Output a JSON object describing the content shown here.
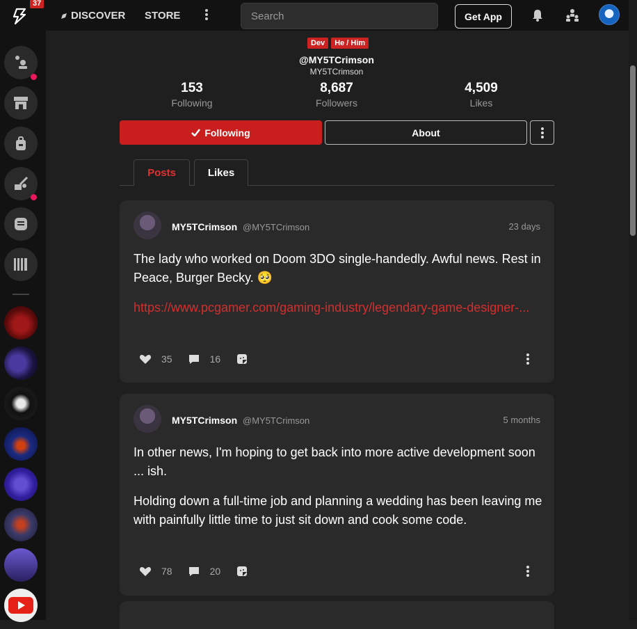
{
  "topbar": {
    "notification_count": "37",
    "discover_label": "DISCOVER",
    "store_label": "STORE",
    "search_placeholder": "Search",
    "get_app_label": "Get App"
  },
  "profile": {
    "badges": [
      "Dev",
      "He / Him"
    ],
    "handle": "@MY5TCrimson",
    "display_name": "MY5TCrimson",
    "stats": [
      {
        "value": "153",
        "label": "Following"
      },
      {
        "value": "8,687",
        "label": "Followers"
      },
      {
        "value": "4,509",
        "label": "Likes"
      }
    ],
    "following_label": "Following",
    "about_label": "About"
  },
  "tabs": [
    {
      "label": "Posts",
      "active": true
    },
    {
      "label": "Likes",
      "active": false
    }
  ],
  "posts": [
    {
      "author": "MY5TCrimson",
      "handle": "@MY5TCrimson",
      "time": "23 days",
      "text": "The lady who worked on Doom 3DO single-handedly. Awful news. Rest in Peace, Burger Becky. 🥺",
      "link": "https://www.pcgamer.com/gaming-industry/legendary-game-designer-...",
      "likes": "35",
      "comments": "16"
    },
    {
      "author": "MY5TCrimson",
      "handle": "@MY5TCrimson",
      "time": "5 months",
      "text": "In other news, I'm hoping to get back into more active development soon ... ish.",
      "text2": "Holding down a full-time job and planning a wedding has been leaving me with painfully little time to just sit down and cook some code.",
      "likes": "78",
      "comments": "20"
    }
  ],
  "colors": {
    "accent": "#c81e1e",
    "link": "#d32f2f",
    "background": "#1f1f1f",
    "card": "#2a2a2a",
    "notification_dot": "#e8185a"
  }
}
